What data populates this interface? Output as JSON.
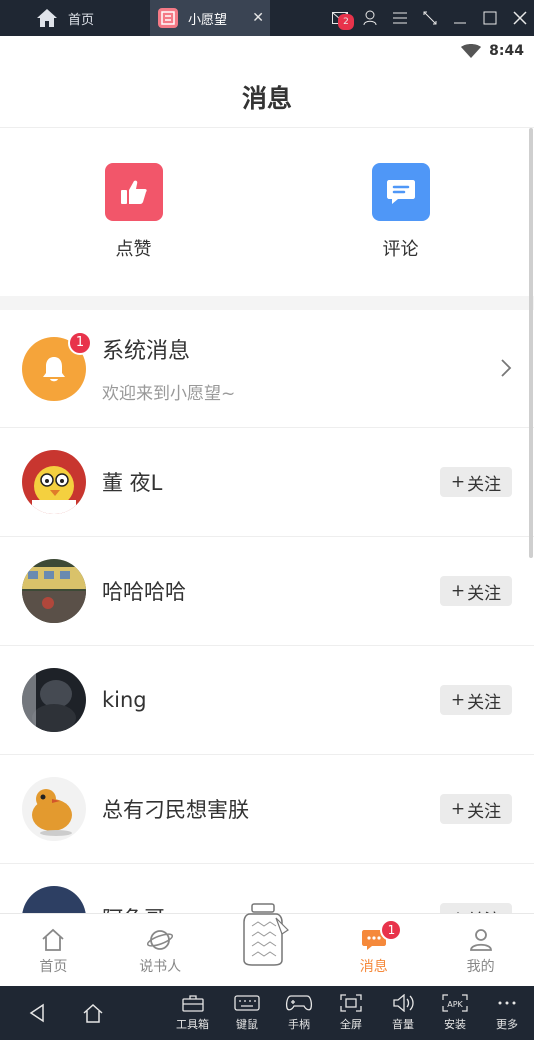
{
  "emulator": {
    "home_tab": "首页",
    "active_tab": "小愿望",
    "mail_badge": "2"
  },
  "status": {
    "time": "8:44"
  },
  "page": {
    "title": "消息"
  },
  "quick_actions": [
    {
      "label": "点赞",
      "icon": "thumbs-up-icon",
      "color": "#f2566a"
    },
    {
      "label": "评论",
      "icon": "comment-icon",
      "color": "#4f97f7"
    }
  ],
  "system_message": {
    "title": "系统消息",
    "preview": "欢迎来到小愿望~",
    "badge": "1"
  },
  "users": [
    {
      "name": "董 夜L",
      "follow": "关注"
    },
    {
      "name": "哈哈哈哈",
      "follow": "关注"
    },
    {
      "name": "king",
      "follow": "关注"
    },
    {
      "name": "总有刁民想害朕",
      "follow": "关注"
    },
    {
      "name": "阿龟哥",
      "follow": "关注"
    }
  ],
  "tabbar": [
    {
      "label": "首页",
      "icon": "home-icon"
    },
    {
      "label": "说书人",
      "icon": "planet-icon"
    },
    {
      "label": "",
      "icon": "wish-jar-icon"
    },
    {
      "label": "消息",
      "icon": "message-icon",
      "badge": "1",
      "active": true
    },
    {
      "label": "我的",
      "icon": "user-icon"
    }
  ],
  "navbar": [
    {
      "label": "",
      "icon": "back-icon"
    },
    {
      "label": "",
      "icon": "home-icon"
    },
    {
      "label": "工具箱",
      "icon": "toolbox-icon"
    },
    {
      "label": "键鼠",
      "icon": "keyboard-icon"
    },
    {
      "label": "手柄",
      "icon": "gamepad-icon"
    },
    {
      "label": "全屏",
      "icon": "fullscreen-icon"
    },
    {
      "label": "音量",
      "icon": "volume-icon"
    },
    {
      "label": "安装",
      "icon": "apk-install-icon"
    },
    {
      "label": "更多",
      "icon": "more-icon"
    }
  ]
}
